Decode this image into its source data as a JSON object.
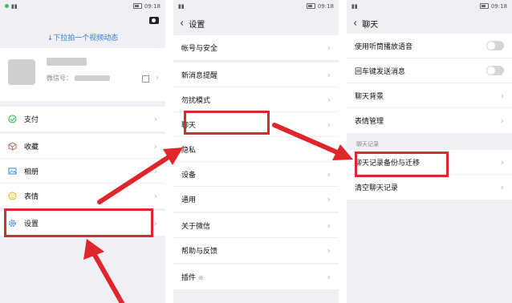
{
  "status": {
    "time": "09:18"
  },
  "screen1": {
    "pull_hint": "↓下拉拍一个视频动态",
    "profile": {
      "wechat_id_label": "微信号："
    },
    "menu": [
      {
        "label": "支付",
        "icon": "payment-icon"
      },
      {
        "label": "收藏",
        "icon": "favorites-icon"
      },
      {
        "label": "相册",
        "icon": "album-icon"
      },
      {
        "label": "表情",
        "icon": "stickers-icon"
      },
      {
        "label": "设置",
        "icon": "settings-gear-icon"
      }
    ]
  },
  "screen2": {
    "title": "设置",
    "items": [
      "帐号与安全",
      "新消息提醒",
      "勿扰模式",
      "聊天",
      "隐私",
      "设备",
      "通用",
      "关于微信",
      "帮助与反馈",
      "插件"
    ]
  },
  "screen3": {
    "title": "聊天",
    "toggles": [
      "使用听筒播放语音",
      "回车键发送消息"
    ],
    "items": [
      "聊天背景",
      "表情管理"
    ],
    "section_label": "聊天记录",
    "history_items": [
      "聊天记录备份与迁移",
      "清空聊天记录"
    ]
  },
  "colors": {
    "highlight_red": "#e0252b",
    "link_blue": "#2f7bd9",
    "success_green": "#3bbf5a"
  }
}
